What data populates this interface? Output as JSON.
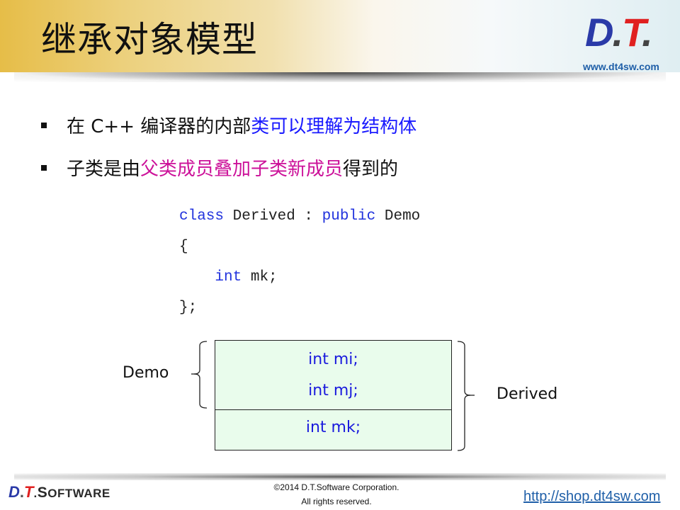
{
  "header": {
    "title": "继承对象模型",
    "logo": {
      "d": "D",
      "dot1": ".",
      "t": "T",
      "dot2": ".",
      "url": "www.dt4sw.com"
    }
  },
  "bullets": [
    {
      "segments": [
        {
          "text": "在 C++ 编译器的内部",
          "color": "black"
        },
        {
          "text": "类可以理解为结构体",
          "color": "blue"
        }
      ]
    },
    {
      "segments": [
        {
          "text": "子类是由",
          "color": "black"
        },
        {
          "text": "父类成员叠加子类新成员",
          "color": "magenta"
        },
        {
          "text": "得到的",
          "color": "black"
        }
      ]
    }
  ],
  "code": {
    "line1": {
      "kw1": "class",
      "name": " Derived : ",
      "kw2": "public",
      "base": " Demo"
    },
    "line2": "{",
    "line3": {
      "indent": "    ",
      "kw": "int",
      "rest": " mk;"
    },
    "line4": "};"
  },
  "diagram": {
    "fields": [
      "int mi;",
      "int mj;",
      "int mk;"
    ],
    "left_label": "Demo",
    "right_label": "Derived",
    "box_fill": "#e9fcec",
    "field_color": "#1a1add"
  },
  "footer": {
    "logo": {
      "d": "D",
      "dot1": ".",
      "t": "T",
      "dot2": ".",
      "s": "S",
      "oftware": "OFTWARE"
    },
    "copyright_line1": "©2014 D.T.Software Corporation.",
    "copyright_line2": "All rights reserved.",
    "link": "http://shop.dt4sw.com"
  }
}
